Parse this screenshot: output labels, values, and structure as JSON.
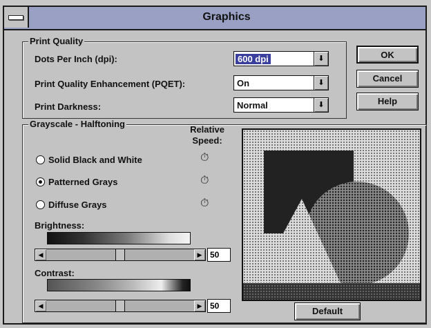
{
  "window": {
    "title": "Graphics"
  },
  "print_quality": {
    "legend": "Print Quality",
    "rows": [
      {
        "label": "Dots Per Inch (dpi):",
        "value": "600 dpi"
      },
      {
        "label": "Print Quality Enhancement (PQET):",
        "value": "On"
      },
      {
        "label": "Print Darkness:",
        "value": "Normal"
      }
    ]
  },
  "buttons": {
    "ok": "OK",
    "cancel": "Cancel",
    "help": "Help",
    "default": "Default"
  },
  "grayscale": {
    "legend": "Grayscale - Halftoning",
    "relative_speed_line1": "Relative",
    "relative_speed_line2": "Speed:",
    "options": [
      {
        "label": "Solid Black and White",
        "selected": false
      },
      {
        "label": "Patterned Grays",
        "selected": true
      },
      {
        "label": "Diffuse Grays",
        "selected": false
      }
    ],
    "brightness": {
      "label": "Brightness:",
      "value": "50"
    },
    "contrast": {
      "label": "Contrast:",
      "value": "50"
    }
  },
  "icons": {
    "system_menu": "dash-icon",
    "dropdown": "down-arrow-icon",
    "speed": "stopwatch-icon"
  },
  "colors": {
    "title_bar": "#9aa0c4",
    "selection": "#3a3f9e"
  }
}
